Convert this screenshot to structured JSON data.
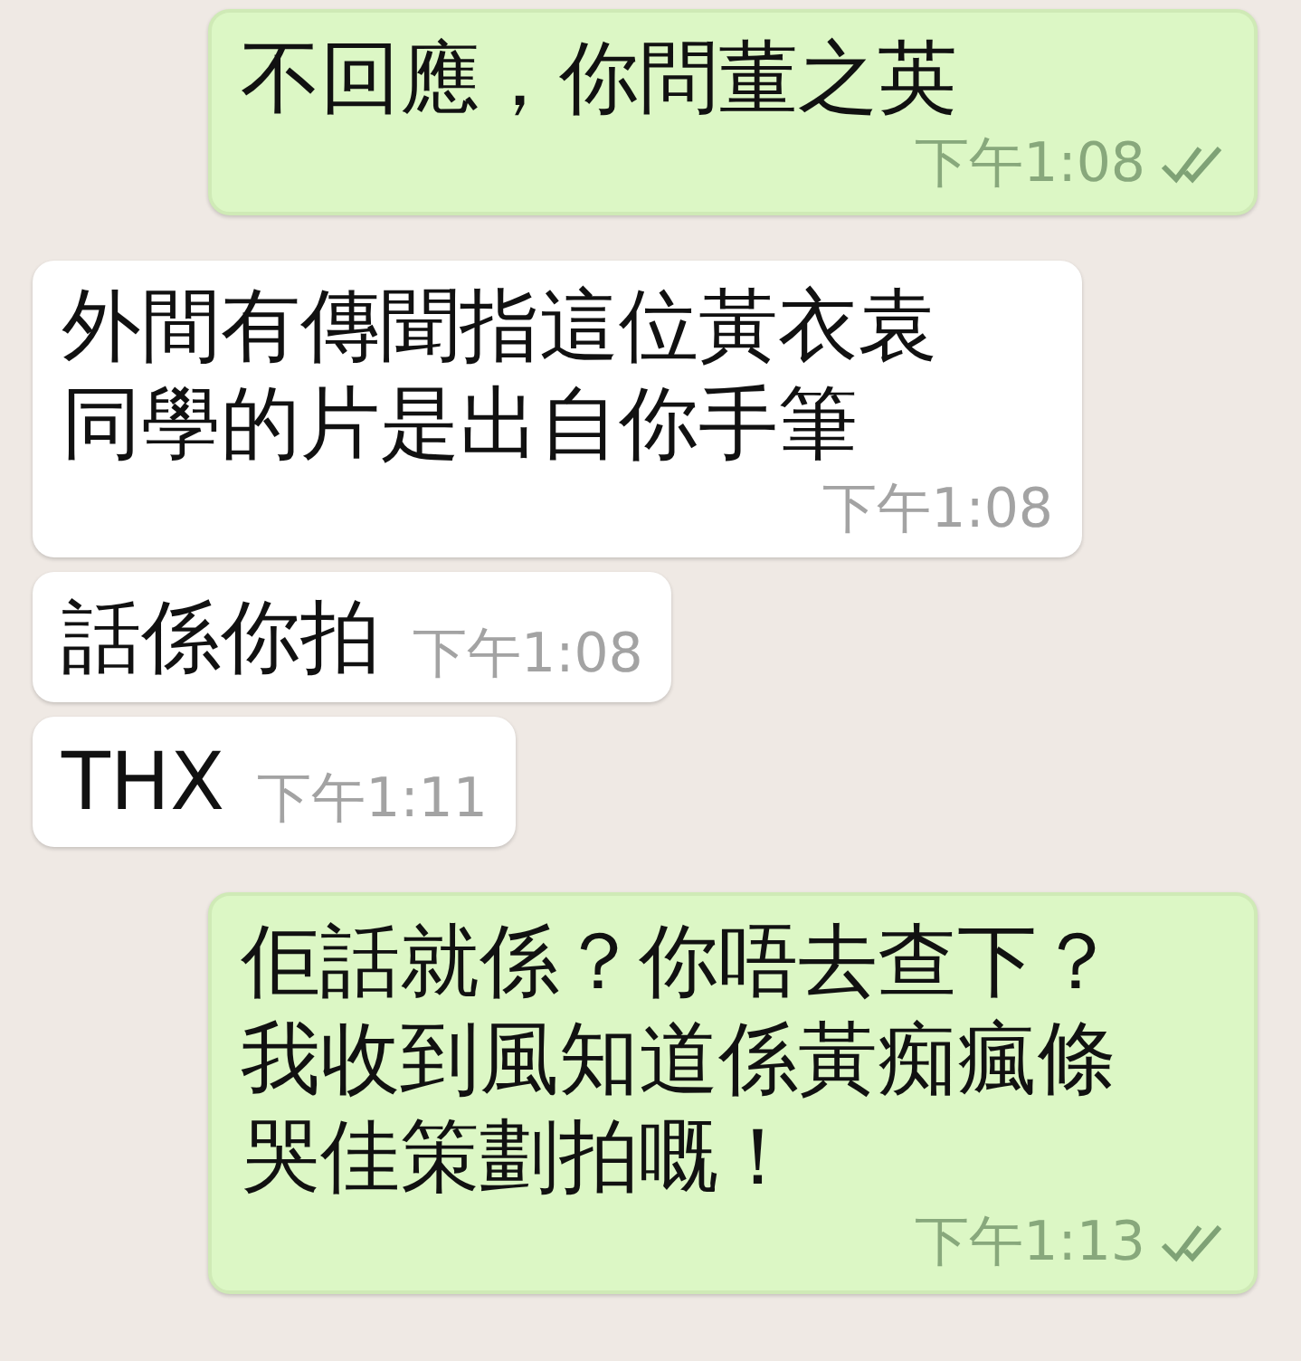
{
  "messages": [
    {
      "outgoing": true,
      "text": "不回應，你問董之英",
      "time": "下午1:08",
      "delivered": true
    },
    {
      "outgoing": false,
      "text": "外間有傳聞指這位黃衣袁同學的片是出自你手筆",
      "time": "下午1:08",
      "delivered": false
    },
    {
      "outgoing": false,
      "text": "話係你拍",
      "time": "下午1:08",
      "delivered": false
    },
    {
      "outgoing": false,
      "text": "THX",
      "time": "下午1:11",
      "delivered": false
    },
    {
      "outgoing": true,
      "text": "佢話就係？你唔去查下？我收到風知道係黃痴瘋條哭佳策劃拍嘅！",
      "time": "下午1:13",
      "delivered": true
    }
  ]
}
